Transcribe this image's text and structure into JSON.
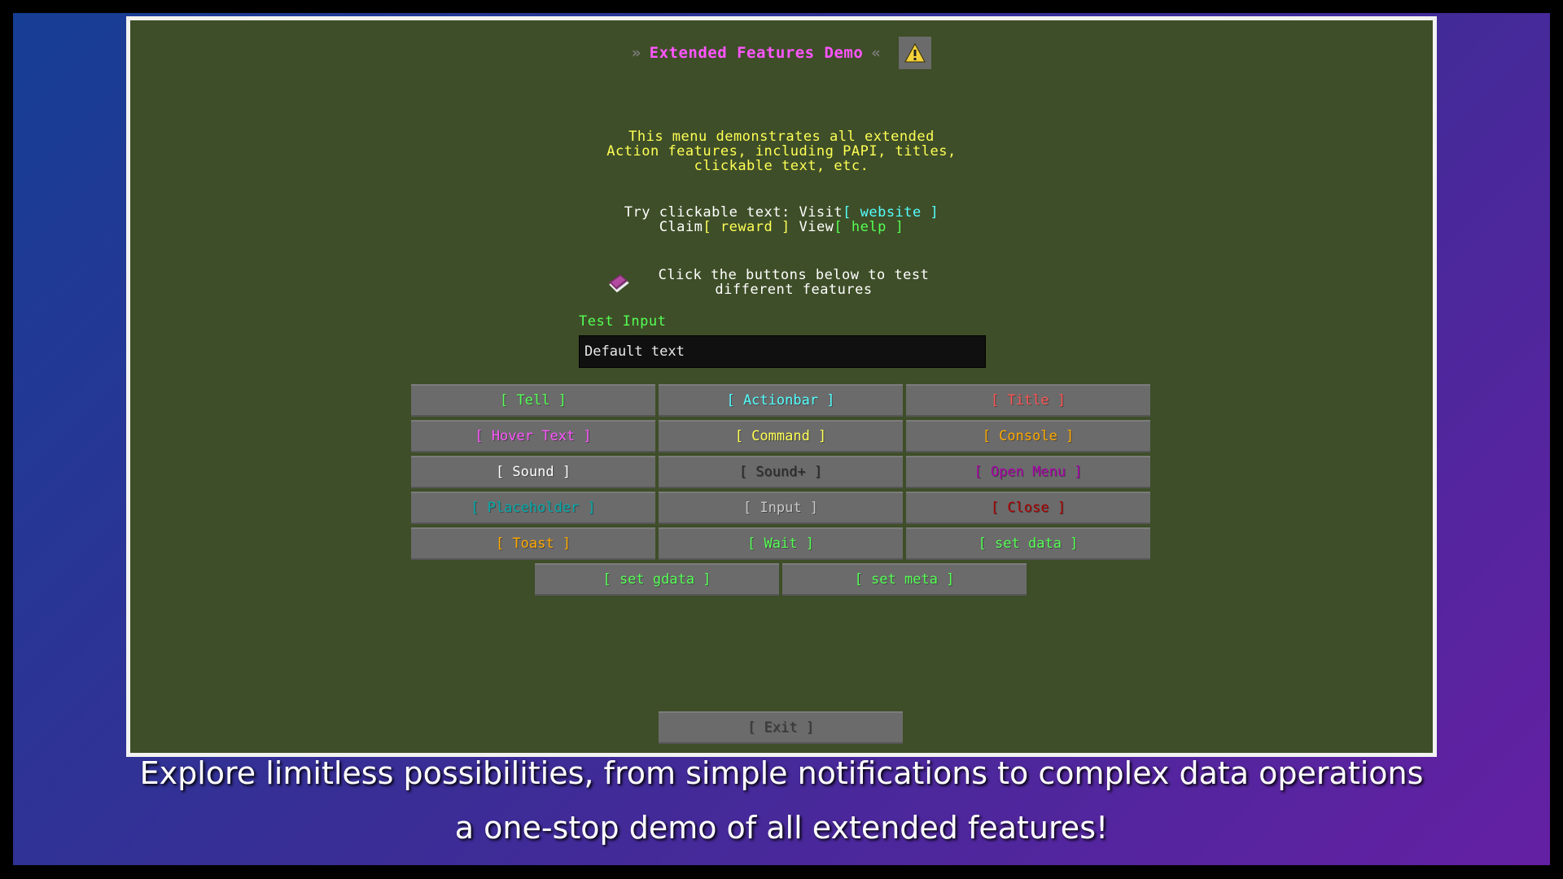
{
  "menu": {
    "title": "Extended Features Demo",
    "title_prefix": "»",
    "title_suffix": "«",
    "warning_icon": "warning-icon",
    "description": "This menu demonstrates all extended\nAction features, including PAPI, titles,\nclickable text, etc.",
    "links": {
      "try_text": "Try clickable text: Visit",
      "website": "[ website ]",
      "claim_text": "Claim",
      "reward": "[ reward ]",
      "view_text": " View",
      "help": "[ help ]"
    },
    "book_icon": "enchanted-book-icon",
    "hint": "Click the buttons below to test\ndifferent features",
    "input_label": "Test Input",
    "input_value": "Default text",
    "buttons": [
      {
        "label": "[ Tell ]",
        "color": "#55ff55"
      },
      {
        "label": "[ Actionbar ]",
        "color": "#55ffff"
      },
      {
        "label": "[ Title ]",
        "color": "#ff5555"
      },
      {
        "label": "[ Hover Text ]",
        "color": "#ff55ff"
      },
      {
        "label": "[ Command ]",
        "color": "#ffff55"
      },
      {
        "label": "[ Console ]",
        "color": "#ffaa00"
      },
      {
        "label": "[ Sound ]",
        "color": "#ffffff"
      },
      {
        "label": "[ Sound+ ]",
        "color": "#2a2a2a"
      },
      {
        "label": "[ Open Menu ]",
        "color": "#aa00aa"
      },
      {
        "label": "[ Placeholder ]",
        "color": "#00aaaa"
      },
      {
        "label": "[ Input ]",
        "color": "#c8c8c8"
      },
      {
        "label": "[ Close ]",
        "color": "#aa0000"
      },
      {
        "label": "[ Toast ]",
        "color": "#ffaa00"
      },
      {
        "label": "[ Wait ]",
        "color": "#55ff55"
      },
      {
        "label": "[ set data ]",
        "color": "#55ff55"
      },
      {
        "label": "[ set gdata ]",
        "color": "#55ff55"
      },
      {
        "label": "[ set meta ]",
        "color": "#55ff55"
      }
    ],
    "exit_button": {
      "label": "[ Exit ]",
      "color": "#3a3a3a"
    }
  },
  "caption": {
    "line1": "Explore limitless possibilities, from simple notifications to complex data operations",
    "line2": "a one-stop demo of all extended features!"
  }
}
